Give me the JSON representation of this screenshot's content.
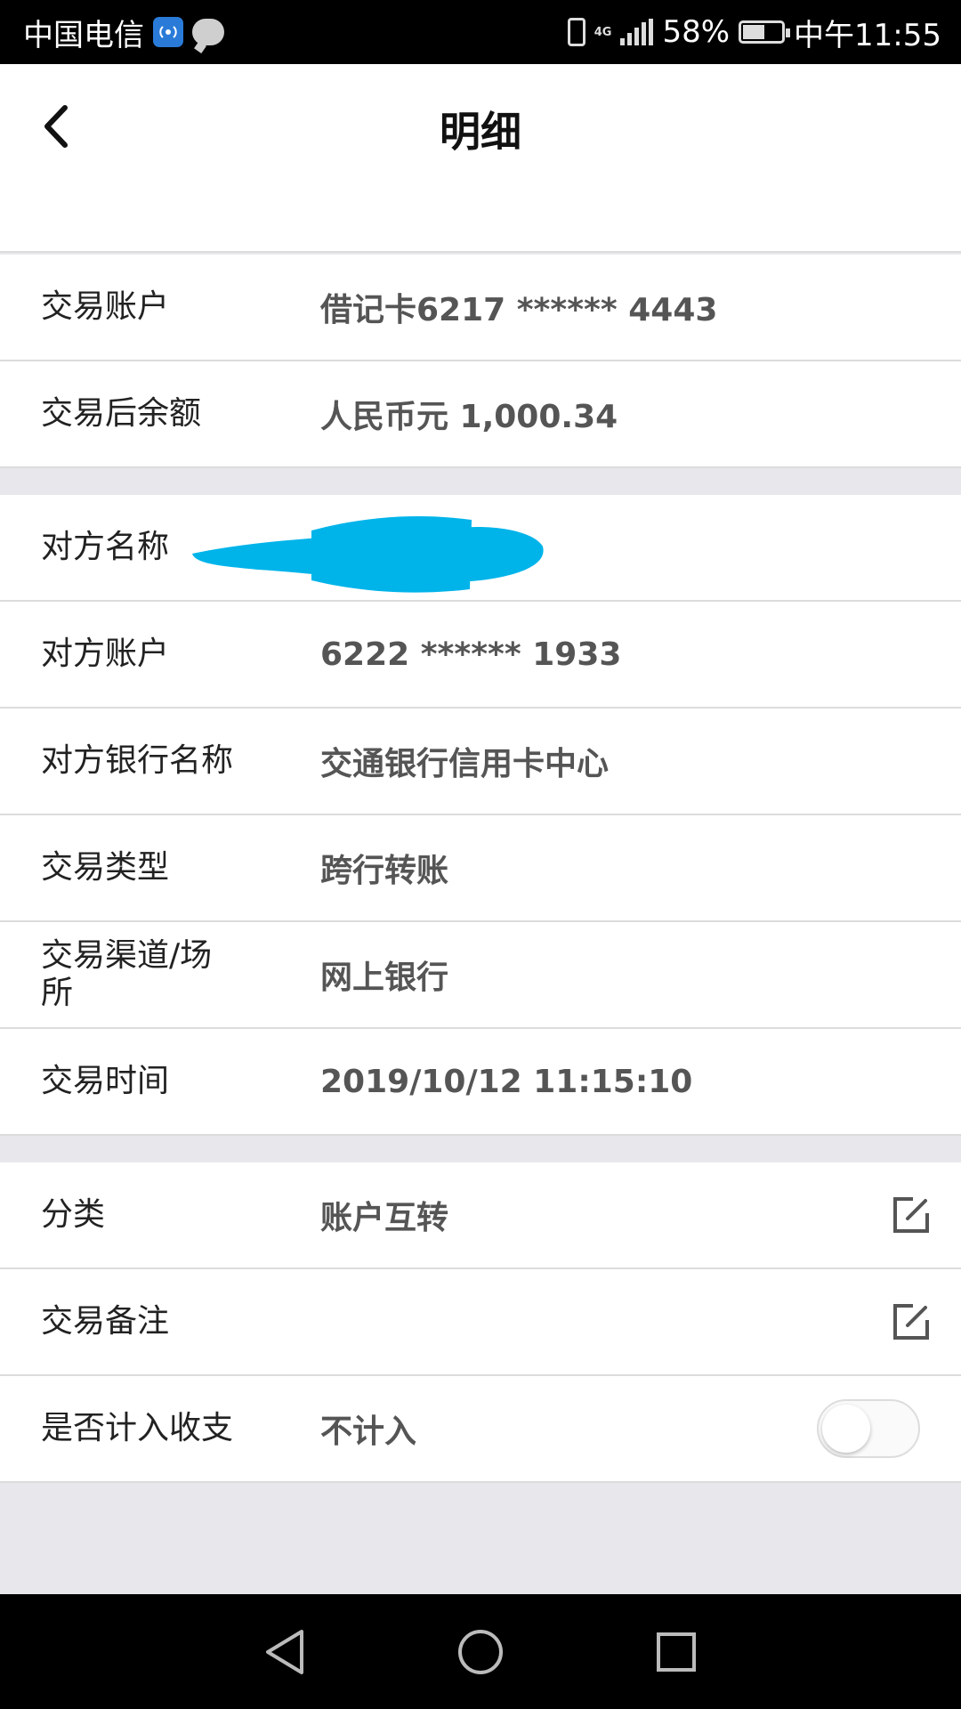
{
  "status_bar": {
    "carrier": "中国电信",
    "battery": "58%",
    "time": "中午11:55",
    "network": "4G",
    "battery_level": 0.58
  },
  "header": {
    "title": "明细"
  },
  "account_group": [
    {
      "label": "交易账户",
      "value": "借记卡6217 ****** 4443"
    },
    {
      "label": "交易后余额",
      "value": "人民币元 1,000.34"
    }
  ],
  "detail_group": [
    {
      "label": "对方名称",
      "value": ""
    },
    {
      "label": "对方账户",
      "value": "6222 ****** 1933"
    },
    {
      "label": "对方银行名称",
      "value": "交通银行信用卡中心"
    },
    {
      "label": "交易类型",
      "value": "跨行转账"
    },
    {
      "label": "交易渠道/场所",
      "value": "网上银行"
    },
    {
      "label": "交易时间",
      "value": "2019/10/12 11:15:10"
    }
  ],
  "settings_group": [
    {
      "label": "分类",
      "value": "账户互转"
    },
    {
      "label": "交易备注",
      "value": ""
    },
    {
      "label": "是否计入收支",
      "value": "不计入",
      "toggle_on": false
    }
  ],
  "colors": {
    "redaction": "#00b4ea",
    "background": "#e8e8ec",
    "value_text": "#555555"
  },
  "icons": {
    "back": "chevron-left-icon",
    "edit": "edit-icon",
    "nav_back": "triangle-back-icon",
    "nav_home": "circle-home-icon",
    "nav_recent": "square-recents-icon"
  }
}
